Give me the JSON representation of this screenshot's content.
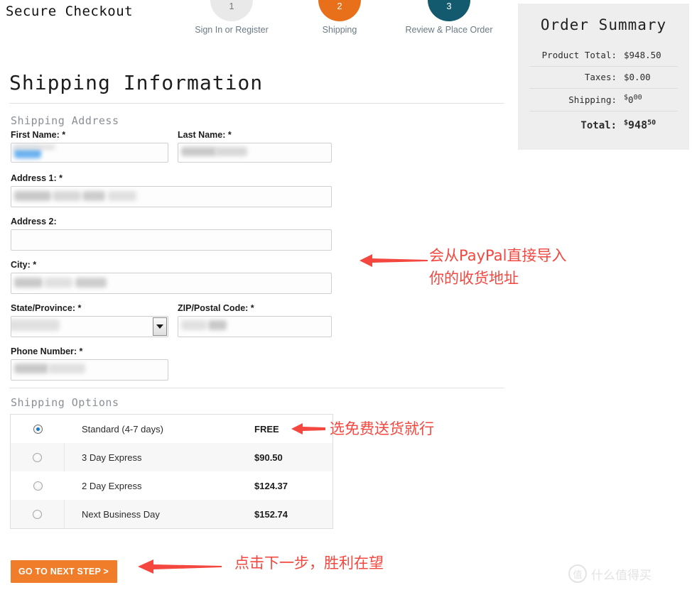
{
  "header": {
    "secure_title": "Secure Checkout",
    "steps": [
      {
        "number": "1",
        "label": "Sign In or Register",
        "state": "inactive",
        "color": "#e9e9e9"
      },
      {
        "number": "2",
        "label": "Shipping",
        "state": "active",
        "color": "#e8701a"
      },
      {
        "number": "3",
        "label": "Review & Place Order",
        "state": "upcoming",
        "color": "#145a6e"
      }
    ]
  },
  "main": {
    "page_heading": "Shipping Information",
    "address_section_title": "Shipping Address",
    "options_section_title": "Shipping Options",
    "fields": {
      "first_name": {
        "label": "First Name: *",
        "value": ""
      },
      "last_name": {
        "label": "Last Name: *",
        "value": ""
      },
      "address1": {
        "label": "Address 1: *",
        "value": ""
      },
      "address2": {
        "label": "Address 2:",
        "value": ""
      },
      "city": {
        "label": "City: *",
        "value": ""
      },
      "state": {
        "label": "State/Province: *",
        "value": ""
      },
      "zip": {
        "label": "ZIP/Postal Code: *",
        "value": ""
      },
      "phone": {
        "label": "Phone Number: *",
        "value": ""
      }
    },
    "shipping_options": [
      {
        "name": "Standard (4-7 days)",
        "price": "FREE",
        "selected": true
      },
      {
        "name": "3 Day Express",
        "price": "$90.50",
        "selected": false
      },
      {
        "name": "2 Day Express",
        "price": "$124.37",
        "selected": false
      },
      {
        "name": "Next Business Day",
        "price": "$152.74",
        "selected": false
      }
    ],
    "next_step_button": "GO TO NEXT STEP >"
  },
  "order_summary": {
    "title": "Order Summary",
    "rows": [
      {
        "label": "Product Total:",
        "value": "$948.50"
      },
      {
        "label": "Taxes:",
        "value": "$0.00"
      }
    ],
    "shipping": {
      "label": "Shipping:",
      "currency": "$",
      "whole": "0",
      "cents": "00"
    },
    "total": {
      "label": "Total:",
      "currency": "$",
      "whole": "948",
      "cents": "50"
    }
  },
  "annotations": {
    "paypal": "会从PayPal直接导入\n你的收货地址",
    "free_shipping": "选免费送货就行",
    "next_step": "点击下一步，胜利在望"
  },
  "watermark": {
    "mark": "值",
    "text": "什么值得买"
  },
  "colors": {
    "accent_orange": "#f07d29",
    "step_active": "#e8701a",
    "step_upcoming": "#145a6e",
    "annotation_red": "#f4473f",
    "summary_bg": "#eeeeee"
  }
}
